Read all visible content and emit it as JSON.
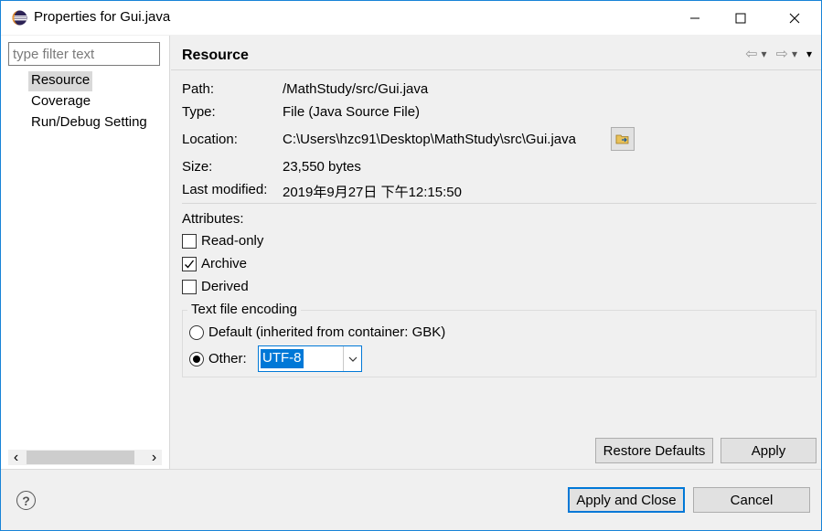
{
  "window": {
    "title": "Properties for Gui.java",
    "icon": "eclipse-icon",
    "controls": [
      "minimize-icon",
      "maximize-icon",
      "close-icon"
    ]
  },
  "sidebar": {
    "filter_placeholder": "type filter text",
    "items": [
      {
        "label": "Resource",
        "selected": true
      },
      {
        "label": "Coverage",
        "selected": false
      },
      {
        "label": "Run/Debug Setting",
        "selected": false
      }
    ],
    "scroll_left": "‹",
    "scroll_right": "›"
  },
  "content": {
    "title": "Resource",
    "nav": {
      "back": "⇦",
      "forward": "⇨",
      "dropdown": "▾",
      "menu": "▾"
    },
    "fields": {
      "path_label": "Path:",
      "path_value": "/MathStudy/src/Gui.java",
      "type_label": "Type:",
      "type_value": "File  (Java Source File)",
      "location_label": "Location:",
      "location_value": "C:\\Users\\hzc91\\Desktop\\MathStudy\\src\\Gui.java",
      "size_label": "Size:",
      "size_value": "23,550  bytes",
      "modified_label": "Last modified:",
      "modified_value": "2019年9月27日 下午12:15:50"
    },
    "attributes": {
      "heading": "Attributes:",
      "read_only": {
        "label": "Read-only",
        "checked": false
      },
      "archive": {
        "label": "Archive",
        "checked": true
      },
      "derived": {
        "label": "Derived",
        "checked": false
      }
    },
    "encoding": {
      "legend": "Text file encoding",
      "default_label": "Default (inherited from container: GBK)",
      "other_label": "Other:",
      "selected": "other",
      "other_value": "UTF-8"
    },
    "buttons": {
      "restore": "Restore Defaults",
      "apply": "Apply"
    }
  },
  "footer": {
    "help": "?",
    "apply_close": "Apply and Close",
    "cancel": "Cancel"
  },
  "colors": {
    "accent": "#0078d7",
    "title_border": "#1883d7"
  }
}
